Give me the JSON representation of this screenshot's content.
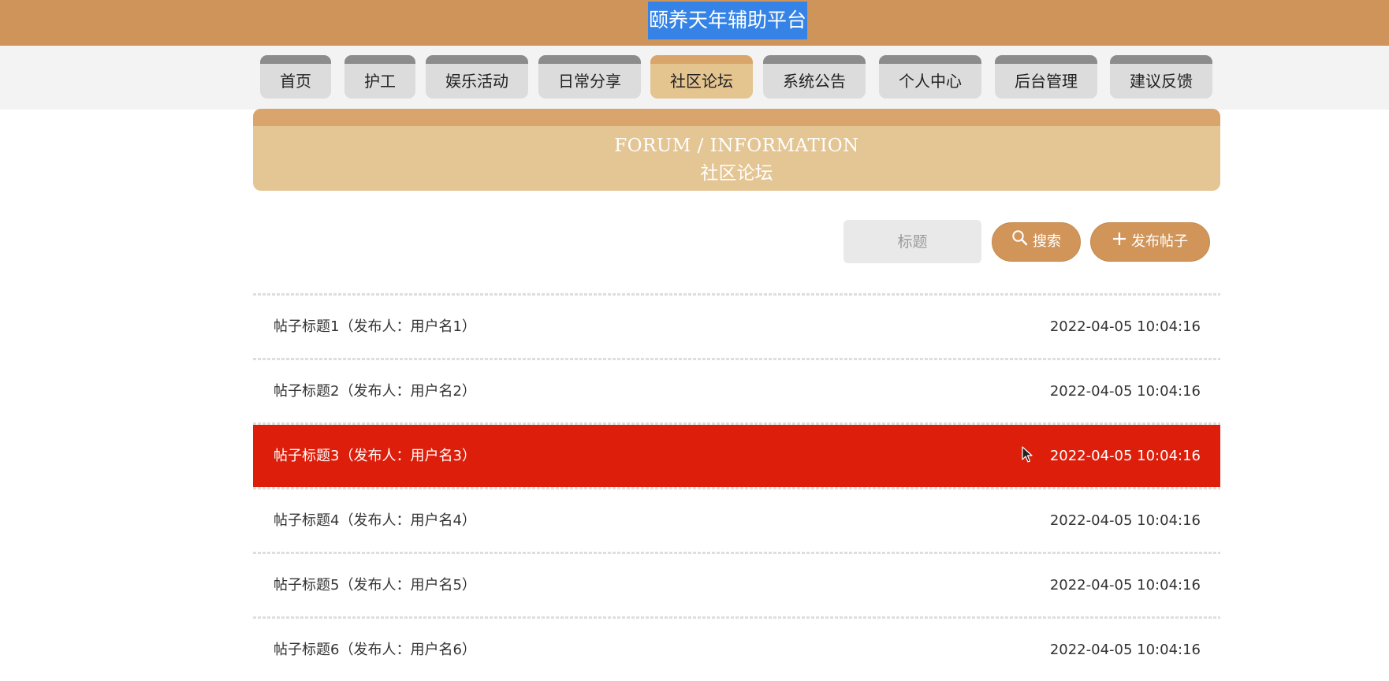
{
  "header": {
    "site_title": "颐养天年辅助平台"
  },
  "nav": {
    "items": [
      {
        "label": "首页"
      },
      {
        "label": "护工"
      },
      {
        "label": "娱乐活动"
      },
      {
        "label": "日常分享"
      },
      {
        "label": "社区论坛",
        "active": true
      },
      {
        "label": "系统公告"
      },
      {
        "label": "个人中心"
      },
      {
        "label": "后台管理"
      },
      {
        "label": "建议反馈"
      }
    ]
  },
  "banner": {
    "title_en": "FORUM / INFORMATION",
    "title_cn": "社区论坛"
  },
  "search": {
    "placeholder": "标题",
    "value": "",
    "search_label": "搜索",
    "publish_label": "发布帖子"
  },
  "posts": [
    {
      "title": "帖子标题1（发布人：用户名1）",
      "time": "2022-04-05 10:04:16"
    },
    {
      "title": "帖子标题2（发布人：用户名2）",
      "time": "2022-04-05 10:04:16"
    },
    {
      "title": "帖子标题3（发布人：用户名3）",
      "time": "2022-04-05 10:04:16",
      "hovered": true
    },
    {
      "title": "帖子标题4（发布人：用户名4）",
      "time": "2022-04-05 10:04:16"
    },
    {
      "title": "帖子标题5（发布人：用户名5）",
      "time": "2022-04-05 10:04:16"
    },
    {
      "title": "帖子标题6（发布人：用户名6）",
      "time": "2022-04-05 10:04:16"
    }
  ],
  "colors": {
    "brand": "#cf9459",
    "nav_active": "#e4c48f",
    "row_highlight": "#dc1e0a",
    "title_selection": "#3583e6"
  },
  "icons": {
    "search": "search-icon",
    "publish": "plus-icon",
    "cursor": "mouse-pointer-icon"
  }
}
